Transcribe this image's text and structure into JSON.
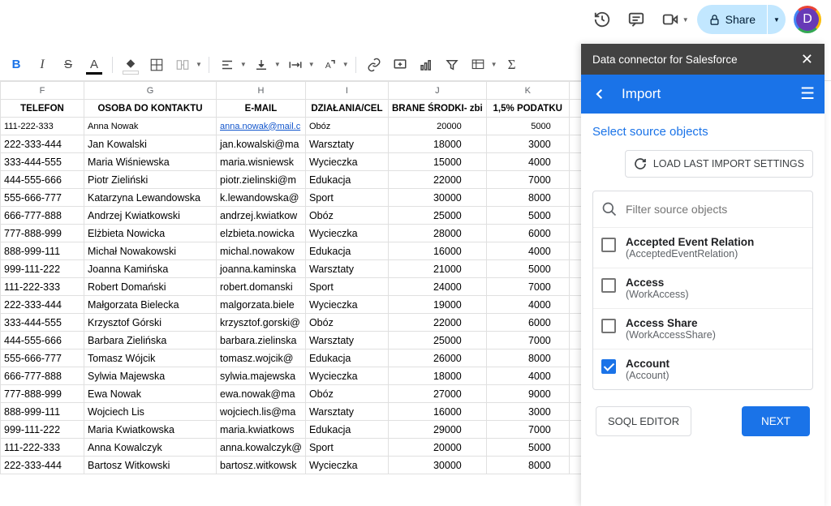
{
  "header": {
    "share_label": "Share",
    "avatar_initial": "D"
  },
  "sheet": {
    "col_letters": [
      "F",
      "G",
      "H",
      "I",
      "J",
      "K",
      ""
    ],
    "headers": [
      "TELEFON",
      "OSOBA DO KONTAKTU",
      "E-MAIL",
      "DZIAŁANIA/CEL",
      "BRANE ŚRODKI- zbi",
      "1,5% PODATKU"
    ],
    "rows": [
      {
        "tel": "111-222-333",
        "osoba": "Anna Nowak",
        "email": "anna.nowak@mail.c",
        "email_link": true,
        "dzial": "Obóz",
        "srodki": "20000",
        "pod": "5000",
        "small": true
      },
      {
        "tel": "222-333-444",
        "osoba": "Jan Kowalski",
        "email": "jan.kowalski@ma",
        "dzial": "Warsztaty",
        "srodki": "18000",
        "pod": "3000"
      },
      {
        "tel": "333-444-555",
        "osoba": "Maria Wiśniewska",
        "email": "maria.wisniewsk",
        "dzial": "Wycieczka",
        "srodki": "15000",
        "pod": "4000"
      },
      {
        "tel": "444-555-666",
        "osoba": "Piotr Zieliński",
        "email": "piotr.zielinski@m",
        "dzial": "Edukacja",
        "srodki": "22000",
        "pod": "7000"
      },
      {
        "tel": "555-666-777",
        "osoba": "Katarzyna Lewandowska",
        "email": "k.lewandowska@",
        "dzial": "Sport",
        "srodki": "30000",
        "pod": "8000"
      },
      {
        "tel": "666-777-888",
        "osoba": "Andrzej Kwiatkowski",
        "email": "andrzej.kwiatkow",
        "dzial": "Obóz",
        "srodki": "25000",
        "pod": "5000"
      },
      {
        "tel": "777-888-999",
        "osoba": "Elżbieta Nowicka",
        "email": "elzbieta.nowicka",
        "dzial": "Wycieczka",
        "srodki": "28000",
        "pod": "6000"
      },
      {
        "tel": "888-999-111",
        "osoba": "Michał Nowakowski",
        "email": "michal.nowakow",
        "dzial": "Edukacja",
        "srodki": "16000",
        "pod": "4000"
      },
      {
        "tel": "999-111-222",
        "osoba": "Joanna Kamińska",
        "email": "joanna.kaminska",
        "dzial": "Warsztaty",
        "srodki": "21000",
        "pod": "5000"
      },
      {
        "tel": "111-222-333",
        "osoba": "Robert Domański",
        "email": "robert.domanski",
        "dzial": "Sport",
        "srodki": "24000",
        "pod": "7000"
      },
      {
        "tel": "222-333-444",
        "osoba": "Małgorzata Bielecka",
        "email": "malgorzata.biele",
        "dzial": "Wycieczka",
        "srodki": "19000",
        "pod": "4000"
      },
      {
        "tel": "333-444-555",
        "osoba": "Krzysztof Górski",
        "email": "krzysztof.gorski@",
        "dzial": "Obóz",
        "srodki": "22000",
        "pod": "6000"
      },
      {
        "tel": "444-555-666",
        "osoba": "Barbara Zielińska",
        "email": "barbara.zielinska",
        "dzial": "Warsztaty",
        "srodki": "25000",
        "pod": "7000"
      },
      {
        "tel": "555-666-777",
        "osoba": "Tomasz Wójcik",
        "email": "tomasz.wojcik@",
        "dzial": "Edukacja",
        "srodki": "26000",
        "pod": "8000"
      },
      {
        "tel": "666-777-888",
        "osoba": "Sylwia Majewska",
        "email": "sylwia.majewska",
        "dzial": "Wycieczka",
        "srodki": "18000",
        "pod": "4000"
      },
      {
        "tel": "777-888-999",
        "osoba": "Ewa Nowak",
        "email": "ewa.nowak@ma",
        "dzial": "Obóz",
        "srodki": "27000",
        "pod": "9000"
      },
      {
        "tel": "888-999-111",
        "osoba": "Wojciech Lis",
        "email": "wojciech.lis@ma",
        "dzial": "Warsztaty",
        "srodki": "16000",
        "pod": "3000"
      },
      {
        "tel": "999-111-222",
        "osoba": "Maria Kwiatkowska",
        "email": "maria.kwiatkows",
        "dzial": "Edukacja",
        "srodki": "29000",
        "pod": "7000"
      },
      {
        "tel": "111-222-333",
        "osoba": "Anna Kowalczyk",
        "email": "anna.kowalczyk@",
        "dzial": "Sport",
        "srodki": "20000",
        "pod": "5000"
      },
      {
        "tel": "222-333-444",
        "osoba": "Bartosz Witkowski",
        "email": "bartosz.witkowsk",
        "dzial": "Wycieczka",
        "srodki": "30000",
        "pod": "8000"
      }
    ]
  },
  "panel": {
    "title": "Data connector for Salesforce",
    "subtitle": "Import",
    "select_source": "Select source objects",
    "load_last": "LOAD LAST IMPORT SETTINGS",
    "filter_placeholder": "Filter source objects",
    "objects": [
      {
        "label": "Accepted Event Relation",
        "api": "(AcceptedEventRelation)",
        "checked": false
      },
      {
        "label": "Access",
        "api": "(WorkAccess)",
        "checked": false
      },
      {
        "label": "Access Share",
        "api": "(WorkAccessShare)",
        "checked": false
      },
      {
        "label": "Account",
        "api": "(Account)",
        "checked": true
      }
    ],
    "soql": "SOQL EDITOR",
    "next": "NEXT"
  }
}
